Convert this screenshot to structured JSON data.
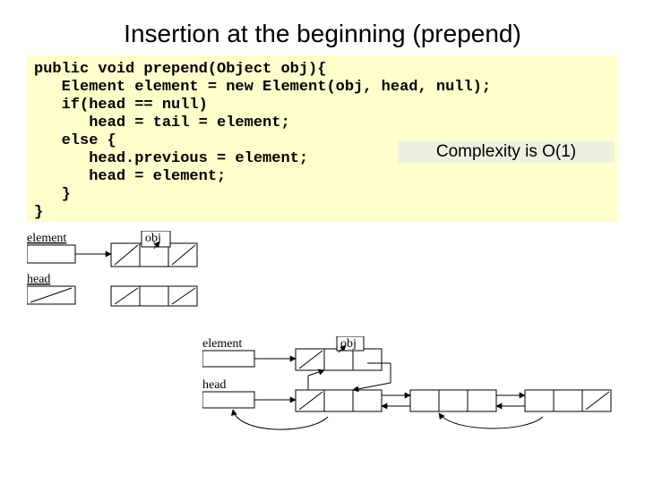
{
  "title": "Insertion at the beginning (prepend)",
  "code": "public void prepend(Object obj){\n   Element element = new Element(obj, head, null);\n   if(head == null)\n      head = tail = element;\n   else {\n      head.previous = element;\n      head = element;\n   }\n}",
  "complexity": "Complexity is O(1)",
  "diagram1": {
    "label_element": "element",
    "label_head": "head",
    "label_obj": "obj"
  },
  "diagram2": {
    "label_element": "element",
    "label_head": "head",
    "label_obj": "obj"
  }
}
